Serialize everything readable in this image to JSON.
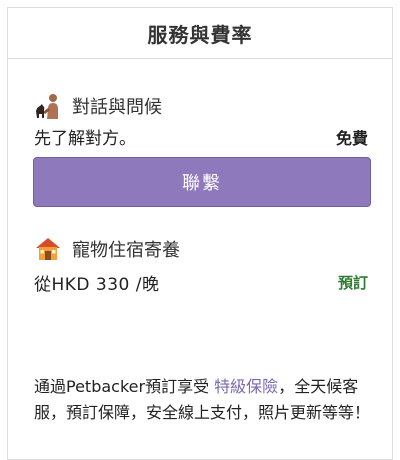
{
  "header": {
    "title": "服務與費率"
  },
  "chat": {
    "title": "對話與問候",
    "description": "先了解對方。",
    "price_label": "免費",
    "icon": "person-with-dog-icon"
  },
  "contact_button": {
    "label": "聯繫"
  },
  "boarding": {
    "title": "寵物住宿寄養",
    "price": "從HKD 330 /晚",
    "book_label": "預訂",
    "icon": "house-icon"
  },
  "footer": {
    "text_before": "通過Petbacker預訂享受 ",
    "link_text": "特級保險",
    "text_after": "，全天候客服，預訂保障，安全線上支付，照片更新等等！"
  },
  "colors": {
    "button": "#8e79bd",
    "book": "#2e7d32",
    "link": "#7a6ab2"
  }
}
